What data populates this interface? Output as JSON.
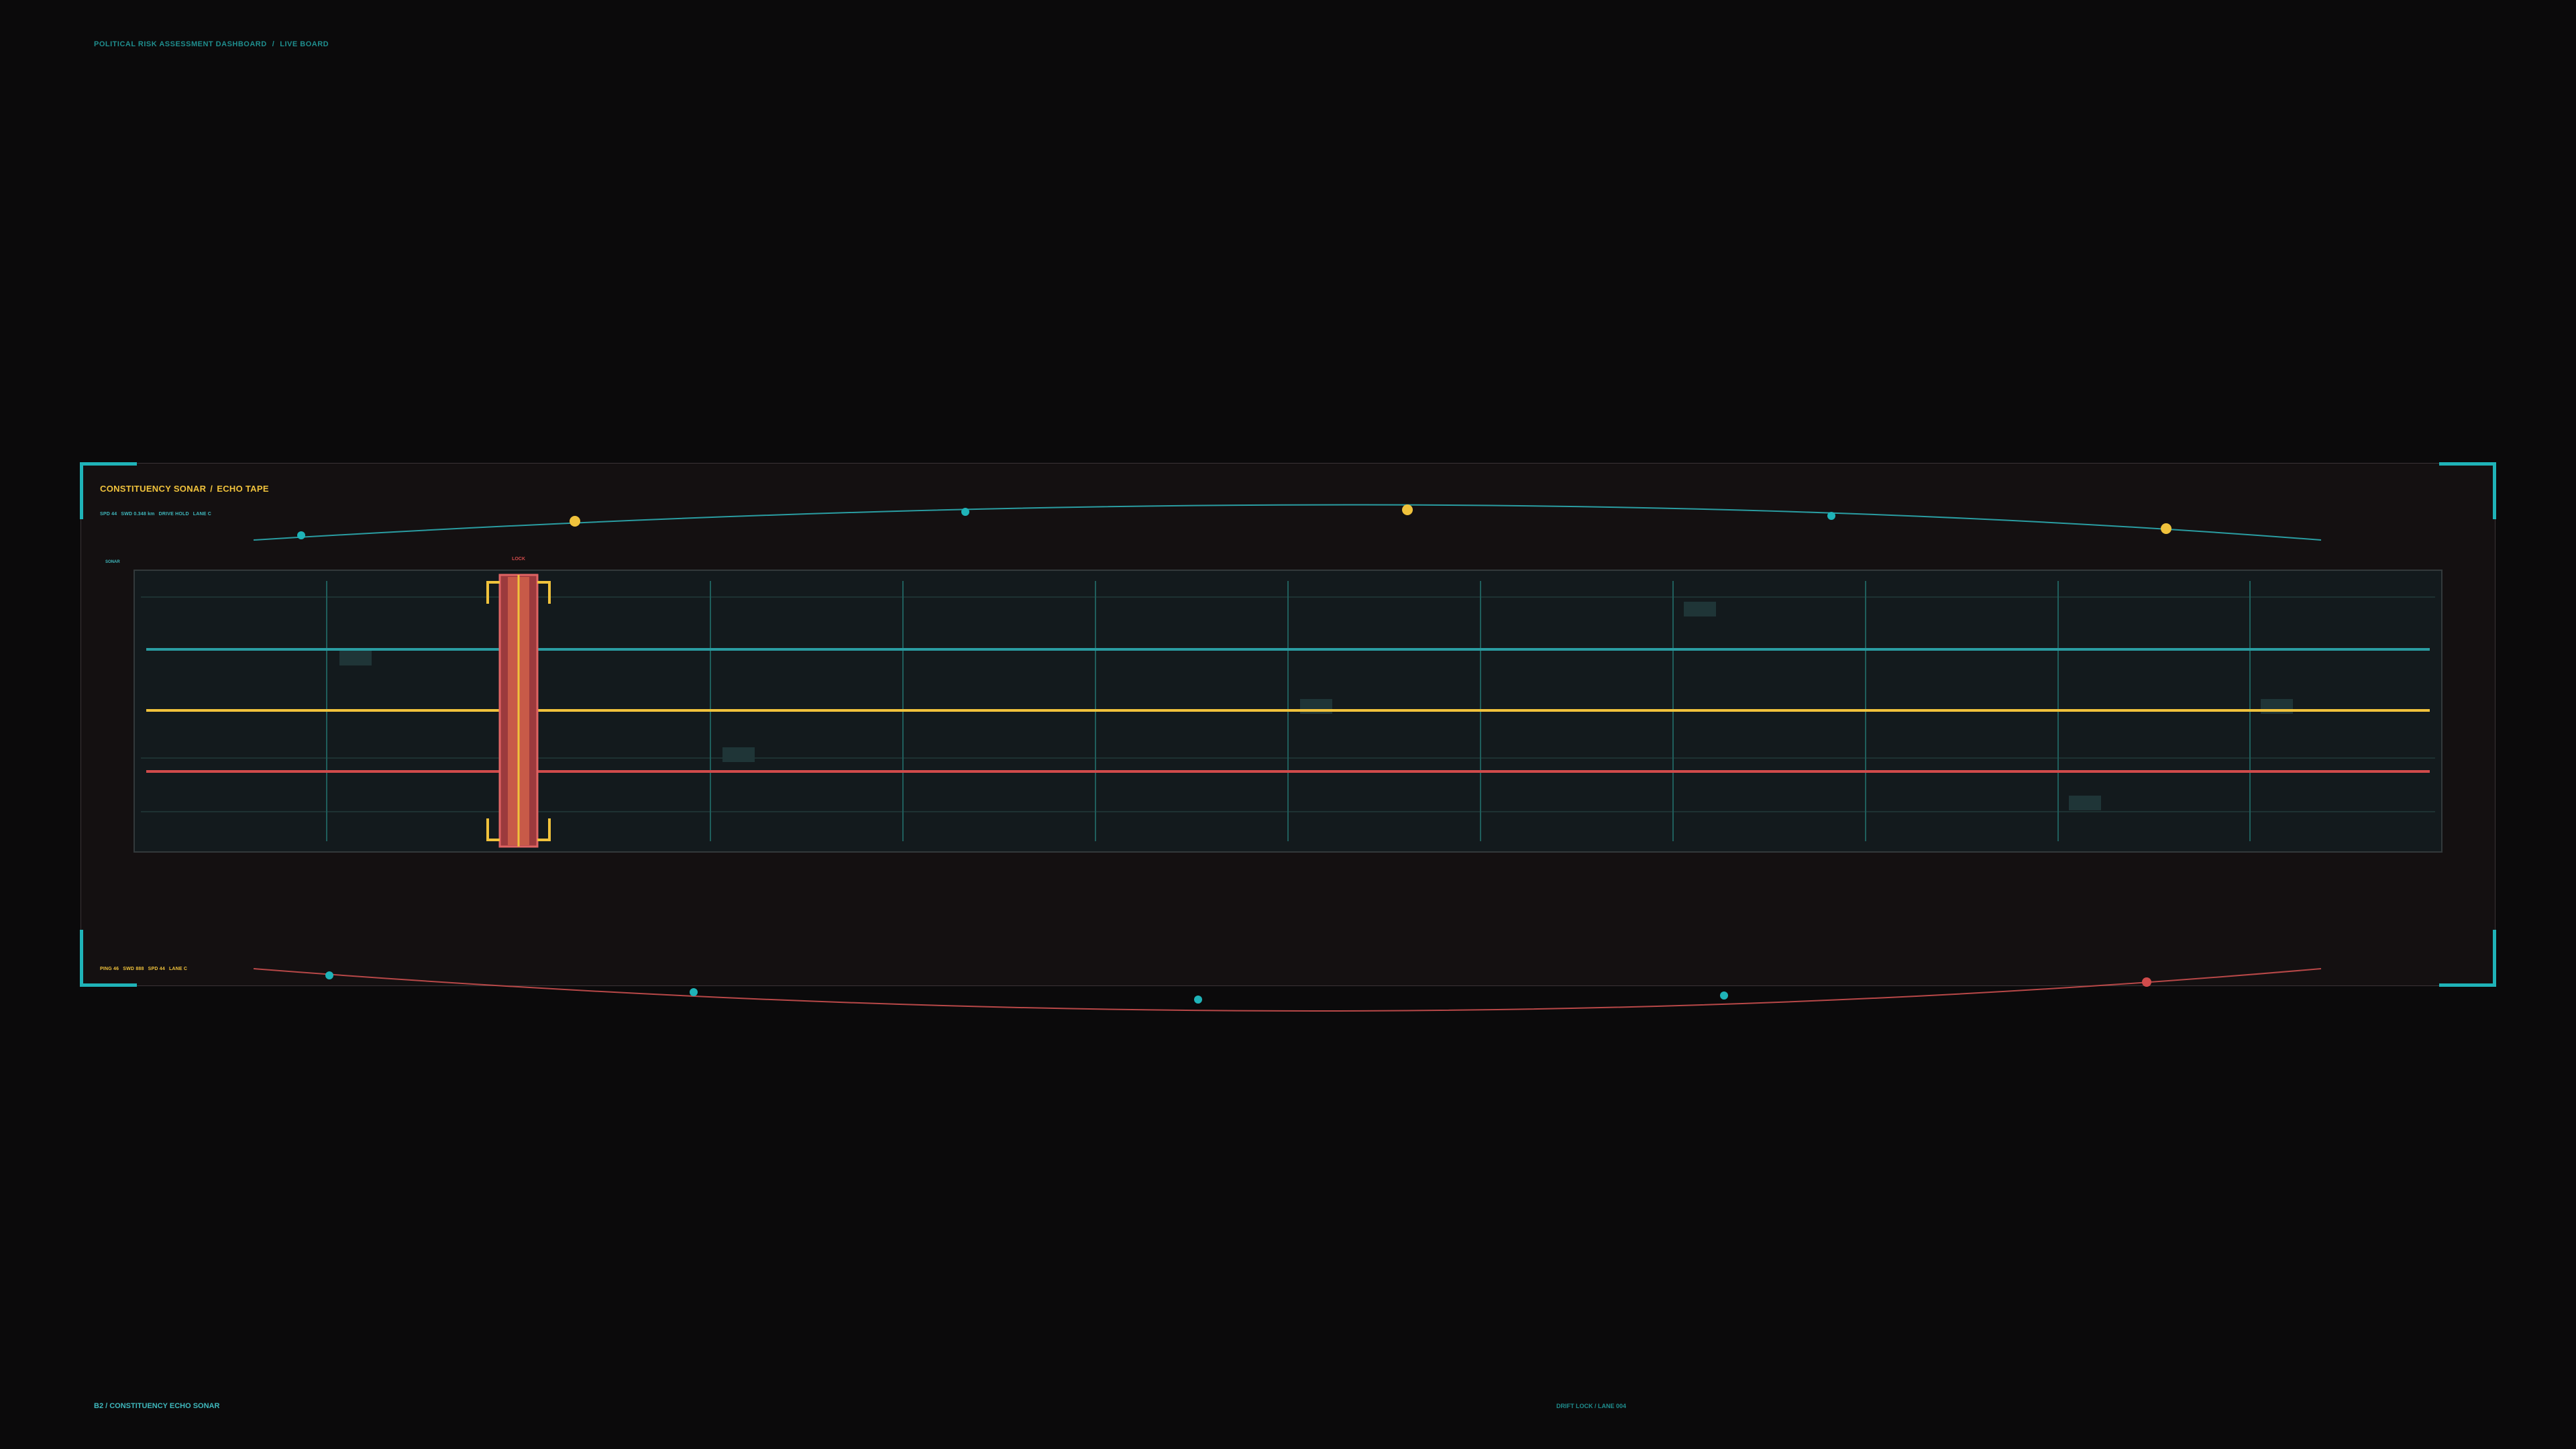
{
  "breadcrumb": {
    "app": "POLITICAL RISK ASSESSMENT DASHBOARD",
    "sep": "/",
    "view": "LIVE BOARD"
  },
  "panel": {
    "title_left": "CONSTITUENCY SONAR",
    "title_sep": "/",
    "title_right": "ECHO TAPE",
    "meta_top": [
      "SPD 44",
      "SWD 0.348 km",
      "DRIVE HOLD",
      "LANE C"
    ],
    "meta_bottom": [
      "PING 46",
      "SWD 888",
      "SPD 44",
      "LANE C"
    ],
    "sonar_label": "SONAR",
    "lock_label": "LOCK",
    "tape_ticks": [
      "",
      "",
      "",
      "",
      "",
      "",
      "",
      "",
      "",
      "",
      "",
      "",
      ""
    ]
  },
  "footer": {
    "left": "B2 / CONSTITUENCY ECHO SONAR",
    "center": "DRIFT LOCK / LANE 004"
  },
  "colors": {
    "background": "#0b0a0b",
    "teal": "#1fb3b8",
    "amber": "#f0c23c",
    "red": "#d04b4b"
  }
}
